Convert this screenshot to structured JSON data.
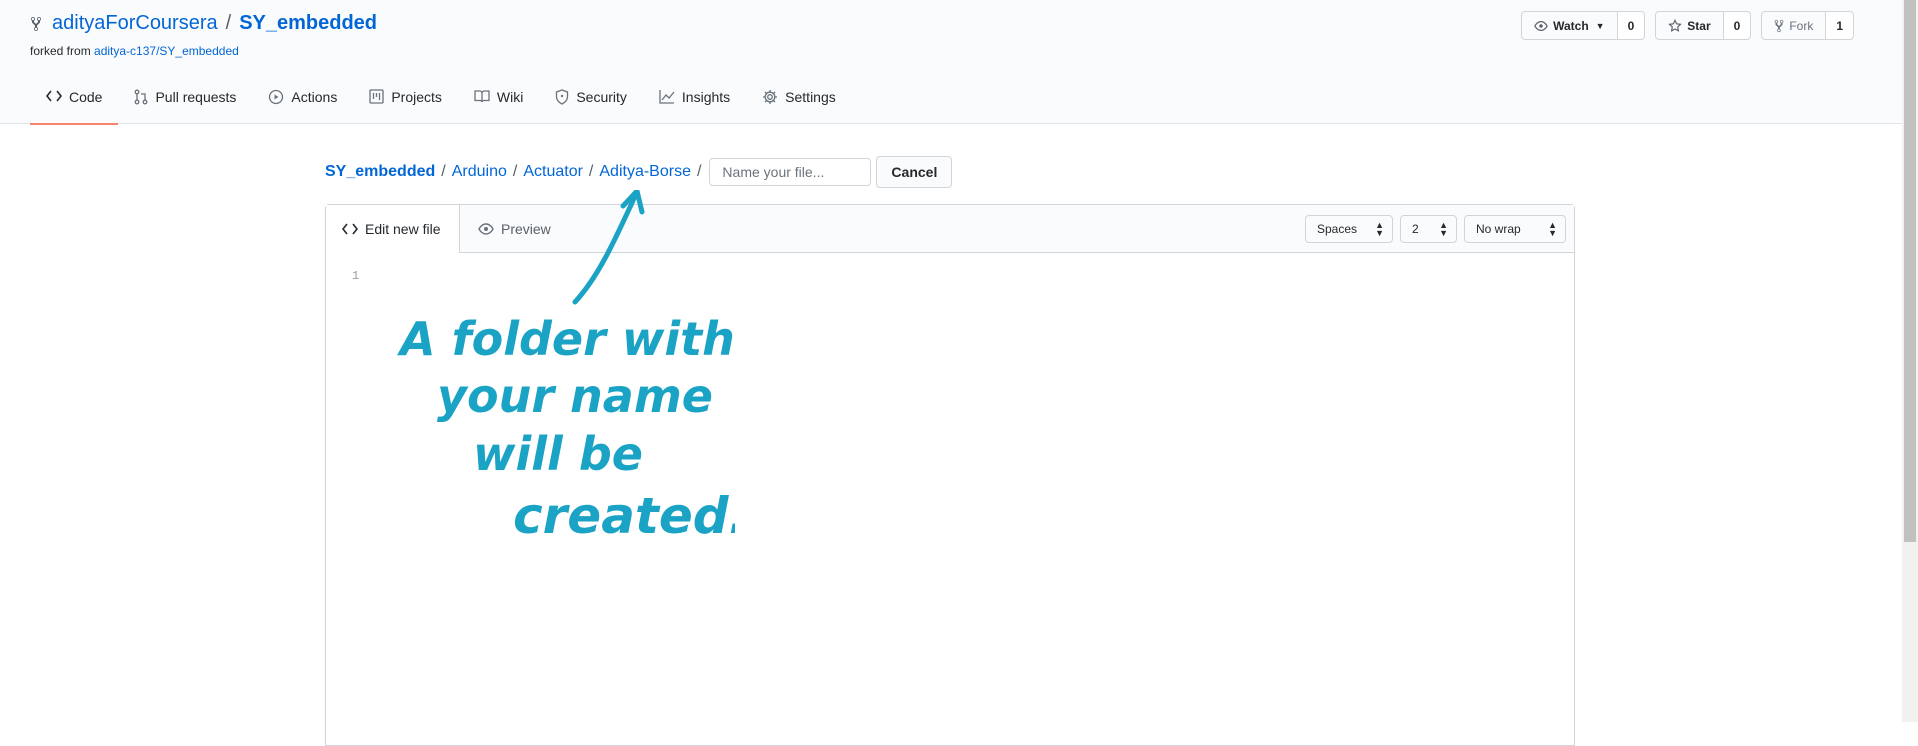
{
  "repo": {
    "owner": "adityaForCoursera",
    "separator": "/",
    "name": "SY_embedded",
    "forked_prefix": "forked from",
    "forked_from": "aditya-c137/SY_embedded"
  },
  "actions": {
    "watch_label": "Watch",
    "watch_count": "0",
    "star_label": "Star",
    "star_count": "0",
    "fork_label": "Fork",
    "fork_count": "1"
  },
  "nav": {
    "tabs": [
      {
        "label": "Code",
        "icon": "code-icon",
        "selected": true
      },
      {
        "label": "Pull requests",
        "icon": "pull-request-icon"
      },
      {
        "label": "Actions",
        "icon": "play-icon"
      },
      {
        "label": "Projects",
        "icon": "project-icon"
      },
      {
        "label": "Wiki",
        "icon": "book-icon"
      },
      {
        "label": "Security",
        "icon": "shield-icon"
      },
      {
        "label": "Insights",
        "icon": "graph-icon"
      },
      {
        "label": "Settings",
        "icon": "gear-icon"
      }
    ]
  },
  "breadcrumb": {
    "items": [
      "SY_embedded",
      "Arduino",
      "Actuator",
      "Aditya-Borse"
    ],
    "separator": "/",
    "filename_placeholder": "Name your file...",
    "cancel_label": "Cancel"
  },
  "editor": {
    "tab_edit": "Edit new file",
    "tab_preview": "Preview",
    "indent_mode": "Spaces",
    "indent_size": "2",
    "wrap_mode": "No wrap",
    "line_number": "1"
  },
  "annotation": {
    "lines": [
      "A folder with",
      "your name",
      "will be",
      "created."
    ],
    "color": "#1aa3c4"
  },
  "colors": {
    "link": "#0366d6",
    "selected_tab_underline": "#f9826c"
  }
}
